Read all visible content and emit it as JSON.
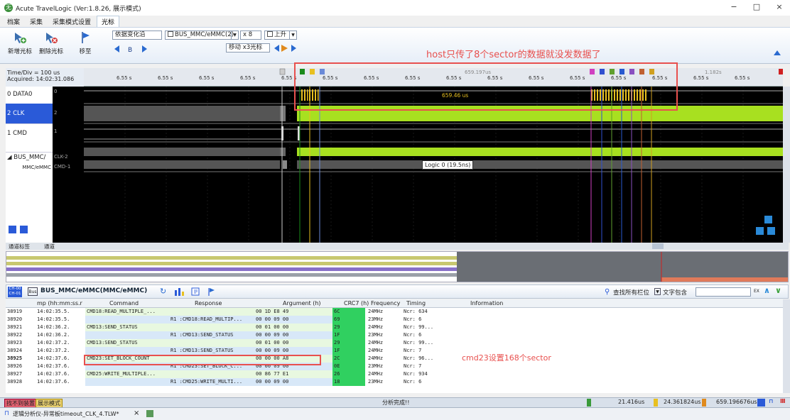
{
  "window": {
    "title": "Acute TravelLogic (Ver:1.8.26, 展示模式)",
    "logo_glyph": "无",
    "minimize": "−",
    "maximize": "□",
    "close": "×"
  },
  "ribbon_tabs": [
    "档案",
    "采集",
    "采集模式设置",
    "光标"
  ],
  "ribbon": {
    "add_cursor": "新增光标",
    "delete_cursor": "删除光标",
    "move_to": "移至",
    "trigger_mode": "依据变化沿",
    "bus_select": "BUS_MMC/eMMC(2)",
    "multiplier": "x 8",
    "edge": "上升",
    "move_cursor": "移动 x3光标",
    "cursor_label": "B"
  },
  "annotations": {
    "top": "host只传了8个sector的数据就没发数据了",
    "bottom": "cmd23设置168个sector"
  },
  "waveform": {
    "time_div": "Time/Div = 100 us",
    "acquired": "Acquired: 14:02:31.086",
    "channels": [
      {
        "name": "0 DATA0",
        "id": "0"
      },
      {
        "name": "2 CLK",
        "id": "2"
      },
      {
        "name": "1 CMD",
        "id": "1"
      },
      {
        "name": "BUS_MMC/",
        "id": "CLK-2"
      },
      {
        "name": "MMC/eMMC",
        "id": "CMD-1"
      }
    ],
    "ruler_labels": [
      "6.55 s",
      "6.55 s",
      "6.55 s",
      "6.55 s",
      "6.55 s",
      "6.55 s",
      "6.55 s",
      "6.55 s",
      "6.55 s",
      "6.55 s",
      "6.55 s",
      "6.55 s",
      "6.55 s",
      "6.55 s",
      "6.55 s",
      "6.55 s",
      "6.55 s"
    ],
    "ruler_marker_1": "659.197us",
    "ruler_marker_2": "1.182s",
    "measure_label": "659.46 us",
    "tooltip": "Logic 0 (19.5ns)",
    "channel_tab": "通道标签",
    "channel_tab2": "通道"
  },
  "proto_bar": {
    "ch_top": "CH-00",
    "ch_bot": "CH-01",
    "bus_tag": "Bus",
    "bus_name": "BUS_MMC/eMMC(MMC/eMMC)",
    "search_placeholder": "查找所有栏位",
    "search_mode": "文字包含",
    "ex_label": "EX"
  },
  "table": {
    "headers": [
      "mp (hh:mm:ss.r",
      "Command",
      "Response",
      "Argument (h)",
      "CRC7 (h)",
      "Frequency",
      "Timing",
      "Information"
    ],
    "rows": [
      {
        "id": "38919",
        "time": "14:02:35.5.",
        "command": "CMD18:READ_MULTIPLE_...",
        "response": "",
        "argument": "00 1D E8 49",
        "crc": "6C",
        "freq": "24MHz",
        "timing": "Ncr: 634"
      },
      {
        "id": "38920",
        "time": "14:02:35.5.",
        "command": "",
        "response": "R1 :CMD18:READ_MULTIP...",
        "argument": "00 00 09 00",
        "crc": "69",
        "freq": "23MHz",
        "timing": "Ncr: 6"
      },
      {
        "id": "38921",
        "time": "14:02:36.2.",
        "command": "CMD13:SEND_STATUS",
        "response": "",
        "argument": "00 01 00 00",
        "crc": "29",
        "freq": "24MHz",
        "timing": "Ncr: 99..."
      },
      {
        "id": "38922",
        "time": "14:02:36.2.",
        "command": "",
        "response": "R1 :CMD13:SEND_STATUS",
        "argument": "00 00 09 00",
        "crc": "1F",
        "freq": "23MHz",
        "timing": "Ncr: 6"
      },
      {
        "id": "38923",
        "time": "14:02:37.2.",
        "command": "CMD13:SEND_STATUS",
        "response": "",
        "argument": "00 01 00 00",
        "crc": "29",
        "freq": "24MHz",
        "timing": "Ncr: 99..."
      },
      {
        "id": "38924",
        "time": "14:02:37.2.",
        "command": "",
        "response": "R1 :CMD13:SEND_STATUS",
        "argument": "00 00 09 00",
        "crc": "1F",
        "freq": "24MHz",
        "timing": "Ncr: 7"
      },
      {
        "id": "38925",
        "time": "14:02:37.6.",
        "command": "CMD23:SET_BLOCK_COUNT",
        "response": "",
        "argument": "00 00 00 A8",
        "crc": "2C",
        "freq": "24MHz",
        "timing": "Ncr: 96..."
      },
      {
        "id": "38926",
        "time": "14:02:37.6.",
        "command": "",
        "response": "R1 :CMD23:SET_BLOCK_C...",
        "argument": "00 00 09 00",
        "crc": "0E",
        "freq": "23MHz",
        "timing": "Ncr: 7"
      },
      {
        "id": "38927",
        "time": "14:02:37.6.",
        "command": "CMD25:WRITE_MULTIPLE...",
        "response": "",
        "argument": "00 86 77 E1",
        "crc": "26",
        "freq": "24MHz",
        "timing": "Ncr: 934"
      },
      {
        "id": "38928",
        "time": "14:02:37.6.",
        "command": "",
        "response": "R1 :CMD25:WRITE_MULTI...",
        "argument": "00 00 09 00",
        "crc": "18",
        "freq": "23MHz",
        "timing": "Ncr: 6"
      }
    ]
  },
  "status": {
    "device": "找不到装置",
    "mode": "展示模式",
    "analysis": "分析完成!!",
    "val_a": "21.416us",
    "val_b": "24.361824us",
    "val_c": "659.196676us"
  },
  "doc_tab": "逻辑分析仪-异常板timeout_CLK_4.TLW*"
}
